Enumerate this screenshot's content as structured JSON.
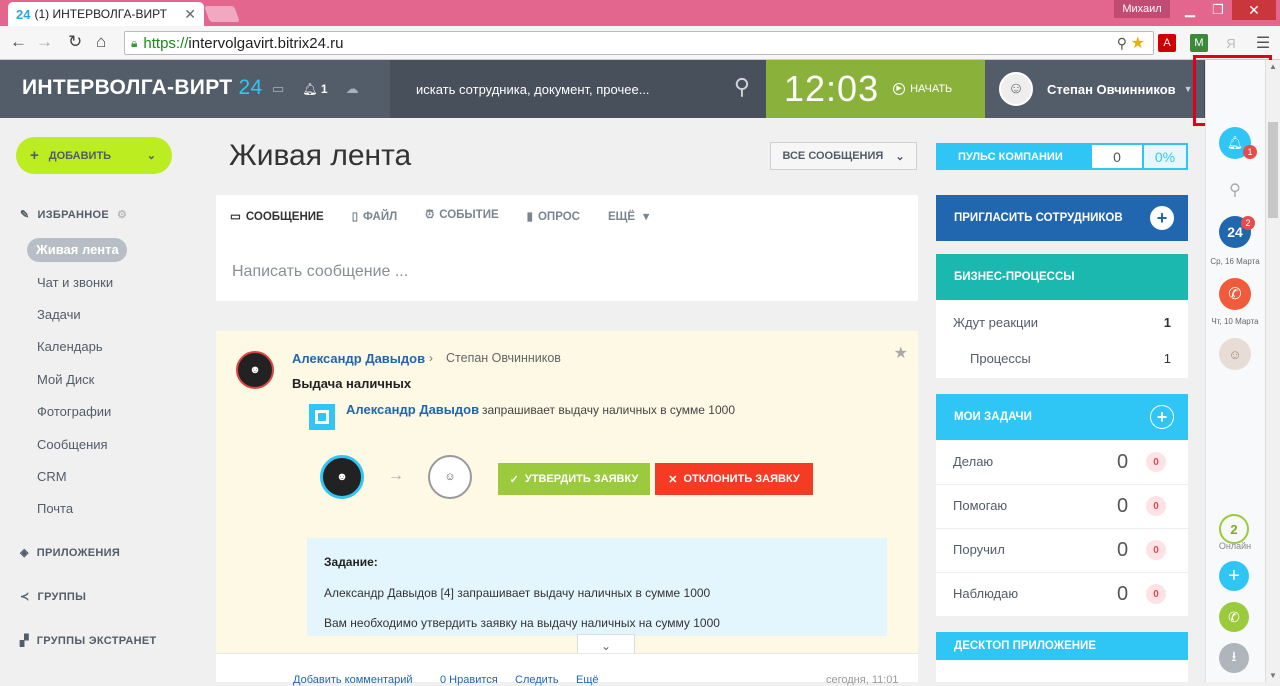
{
  "browser": {
    "tab_title": "(1) ИНТЕРВОЛГА-ВИРТ",
    "tab_icon": "24",
    "window_user": "Михаил",
    "url_scheme": "https://",
    "url_host": "intervolgavirt.bitrix24.ru"
  },
  "header": {
    "logo_text": "ИНТЕРВОЛГА-ВИРТ",
    "logo_suffix": "24",
    "notifications_count": "1",
    "search_placeholder": "искать сотрудника, документ, прочее...",
    "clock_time": "12:03",
    "start_label": "НАЧАТЬ",
    "user_name": "Степан Овчинников",
    "help_label": "?"
  },
  "sidebar": {
    "add_label": "ДОБАВИТЬ",
    "favorites_label": "ИЗБРАННОЕ",
    "active_item": "Живая лента",
    "items": [
      "Чат и звонки",
      "Задачи",
      "Календарь",
      "Мой Диск",
      "Фотографии",
      "Сообщения",
      "CRM",
      "Почта"
    ],
    "apps_label": "ПРИЛОЖЕНИЯ",
    "groups_label": "ГРУППЫ",
    "extranet_label": "ГРУППЫ ЭКСТРАНЕТ"
  },
  "feed": {
    "title": "Живая лента",
    "filter_label": "ВСЕ СООБЩЕНИЯ",
    "composer_tabs": [
      "СООБЩЕНИЕ",
      "ФАЙЛ",
      "СОБЫТИЕ",
      "ОПРОС",
      "ЕЩЁ"
    ],
    "composer_placeholder": "Написать сообщение ...",
    "post": {
      "author": "Александр Давыдов",
      "recipient": "Степан Овчинников",
      "subject": "Выдача наличных",
      "bp_author": "Александр Давыдов",
      "bp_text": "запрашивает выдачу наличных в сумме 1000",
      "approve_label": "УТВЕРДИТЬ ЗАЯВКУ",
      "reject_label": "ОТКЛОНИТЬ ЗАЯВКУ",
      "task_label": "Задание:",
      "task_line1": "Александр Давыдов [4] запрашивает выдачу наличных в сумме 1000",
      "task_line2": "Вам необходимо утвердить заявку на выдачу наличных на сумму 1000",
      "footer": [
        "Добавить комментарий",
        "0 Нравится",
        "Следить",
        "Ещё",
        "сегодня, 11:01"
      ]
    }
  },
  "widgets": {
    "pulse_label": "ПУЛЬС КОМПАНИИ",
    "pulse_value": "0",
    "pulse_percent": "0%",
    "invite_label": "ПРИГЛАСИТЬ СОТРУДНИКОВ",
    "bp_label": "БИЗНЕС-ПРОЦЕССЫ",
    "bp_waiting_label": "Ждут реакции",
    "bp_waiting_value": "1",
    "bp_processes_label": "Процессы",
    "bp_processes_value": "1",
    "tasks_label": "МОИ ЗАДАЧИ",
    "tasks": [
      {
        "label": "Делаю",
        "count": "0",
        "badge": "0"
      },
      {
        "label": "Помогаю",
        "count": "0",
        "badge": "0"
      },
      {
        "label": "Поручил",
        "count": "0",
        "badge": "0"
      },
      {
        "label": "Наблюдаю",
        "count": "0",
        "badge": "0"
      }
    ],
    "desktop_label": "ДЕСКТОП ПРИЛОЖЕНИЕ"
  },
  "rail": {
    "bell_badge": "1",
    "chat_badge": "2",
    "date1": "Ср, 16 Марта",
    "date2": "Чт, 10 Марта",
    "online_count": "2",
    "online_label": "Онлайн"
  },
  "colors": {
    "header": "#535c69",
    "accent": "#2fc6f6",
    "clock": "#8ab23a",
    "add_button": "#bbed21",
    "bp_teal": "#1bb8b0",
    "reject": "#f53b24",
    "approve": "#9bcb3c"
  }
}
